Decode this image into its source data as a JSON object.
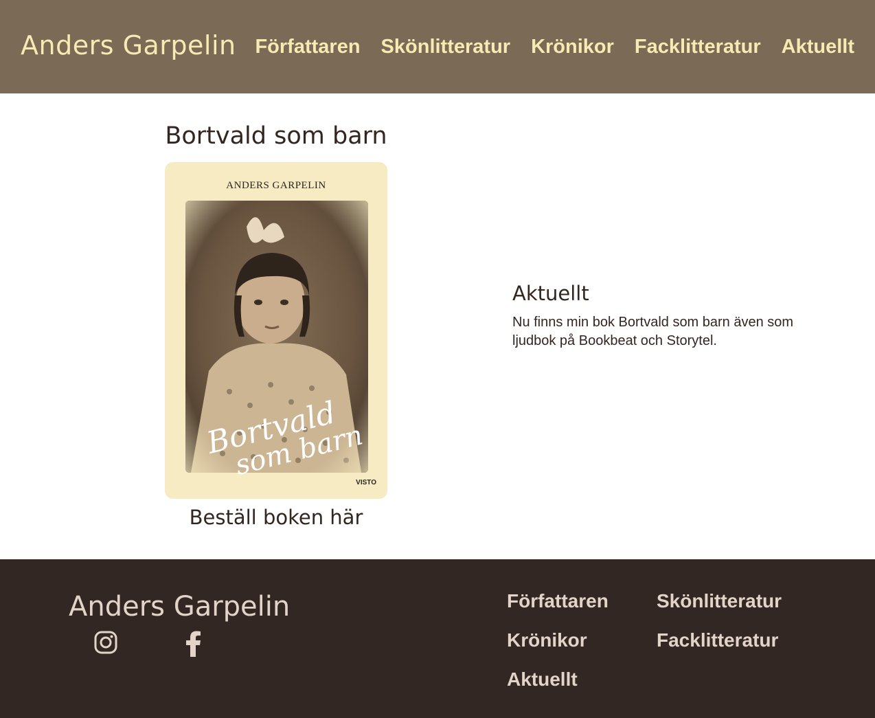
{
  "header": {
    "brand": "Anders Garpelin",
    "nav": [
      "Författaren",
      "Skönlitteratur",
      "Krönikor",
      "Facklitteratur",
      "Aktuellt"
    ]
  },
  "book": {
    "title": "Bortvald som barn",
    "cover_author": "ANDERS GARPELIN",
    "cover_title_line1": "Bortvald",
    "cover_title_line2": "som barn",
    "cover_publisher": "VISTO",
    "order_link": "Beställ boken här"
  },
  "news": {
    "heading": "Aktuellt",
    "text": "Nu finns min bok Bortvald som barn även som ljudbok på Bookbeat och Storytel."
  },
  "footer": {
    "brand": "Anders Garpelin",
    "social": [
      "instagram-icon",
      "facebook-icon"
    ],
    "nav": [
      "Författaren",
      "Skönlitteratur",
      "Krönikor",
      "Facklitteratur",
      "Aktuellt"
    ]
  },
  "colors": {
    "header_bg": "#7b6a55",
    "header_text": "#f7eab3",
    "body_text": "#33261f",
    "footer_bg": "#332724",
    "footer_text": "#e3d4ca"
  }
}
